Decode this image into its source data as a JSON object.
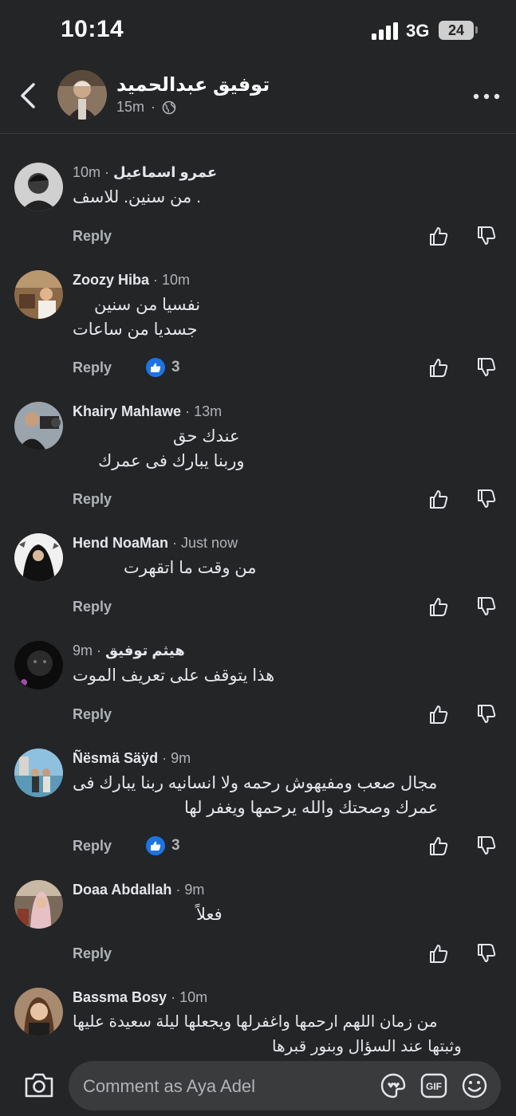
{
  "status_bar": {
    "time": "10:14",
    "network": "3G",
    "battery": "24"
  },
  "header": {
    "name": "توفيق عبدالحميد",
    "time": "15m",
    "privacy_icon": "globe-icon"
  },
  "comments": [
    {
      "name": "عمرو اسماعيل",
      "time": "10m",
      "lines": [
        "من سنين. للاسف ."
      ],
      "reply": "Reply"
    },
    {
      "name": "Zoozy Hiba",
      "time": "10m",
      "lines": [
        "نفسيا من سنين",
        "جسديا من ساعات"
      ],
      "reply": "Reply",
      "likes": "3"
    },
    {
      "name": "Khairy Mahlawe",
      "time": "13m",
      "lines": [
        "عندك حق",
        "وربنا يبارك فى عمرك"
      ],
      "reply": "Reply"
    },
    {
      "name": "Hend NoaMan",
      "time": "Just now",
      "lines": [
        "من وقت ما اتقهرت"
      ],
      "reply": "Reply"
    },
    {
      "name": "هيثم  توفيق",
      "time": "9m",
      "lines": [
        "هذا يتوقف على تعريف الموت"
      ],
      "reply": "Reply"
    },
    {
      "name": "Ñësmä Säÿd",
      "time": "9m",
      "lines": [
        "مجال صعب ومفيهوش رحمه ولا انسانيه ربنا يبارك فى",
        "عمرك وصحتك والله يرحمها ويغفر لها"
      ],
      "reply": "Reply",
      "likes": "3"
    },
    {
      "name": "Doaa Abdallah",
      "time": "9m",
      "lines": [
        "فعلاً"
      ],
      "reply": "Reply"
    },
    {
      "name": "Bassma Bosy",
      "time": "10m",
      "lines": [
        "من زمان اللهم ارحمها واغفرلها ويجعلها ليلة سعيدة عليها",
        "وثبتها عند السؤال وبنور قبرها"
      ]
    }
  ],
  "composer": {
    "placeholder": "Comment as Aya Adel",
    "gif_label": "GIF"
  },
  "colors": {
    "background": "#242526",
    "like_blue": "#1b74e4",
    "secondary_text": "#b0b3b8"
  }
}
